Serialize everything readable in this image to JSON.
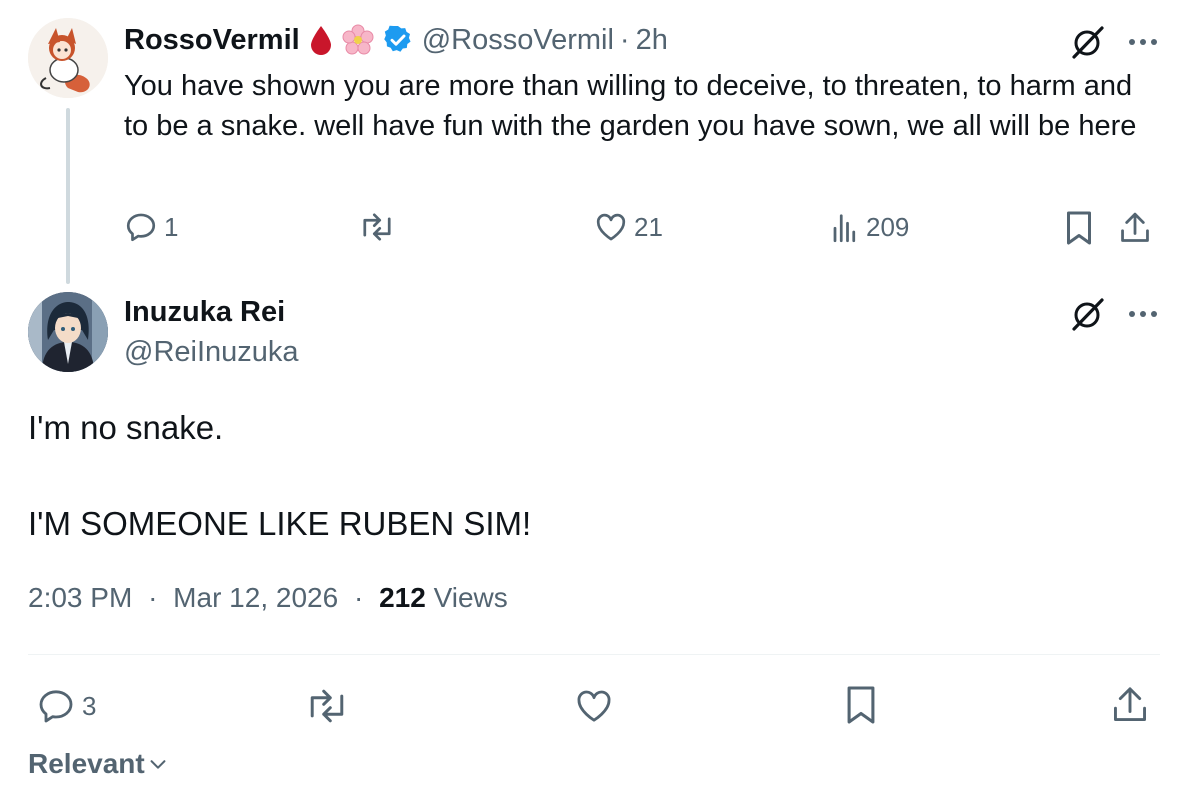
{
  "parent_tweet": {
    "display_name": "RossoVermil",
    "handle": "@RossoVermil",
    "separator": "·",
    "time_ago": "2h",
    "text": "You have shown you are more than willing to deceive, to threaten, to harm and to be a snake. well have fun with the garden you have sown, we all will be here",
    "badges": [
      "blood-drop-emoji",
      "cherry-blossom-emoji",
      "verified-badge"
    ],
    "replies": "1",
    "retweets": "",
    "likes": "21",
    "views": "209"
  },
  "main_tweet": {
    "display_name": "Inuzuka Rei",
    "handle": "@ReiInuzuka",
    "text_line1": "I'm no snake.",
    "text_line2": "I'M SOMEONE LIKE RUBEN SIM!",
    "time": "2:03 PM",
    "separator": "·",
    "date": "Mar 12, 2026",
    "views_count": "212",
    "views_label": "Views",
    "replies": "3"
  },
  "sort": {
    "label": "Relevant"
  },
  "colors": {
    "text_primary": "#0f1419",
    "text_secondary": "#536471",
    "verified": "#1d9bf0",
    "thread_line": "#cfd9de",
    "divider": "#eff3f4"
  }
}
